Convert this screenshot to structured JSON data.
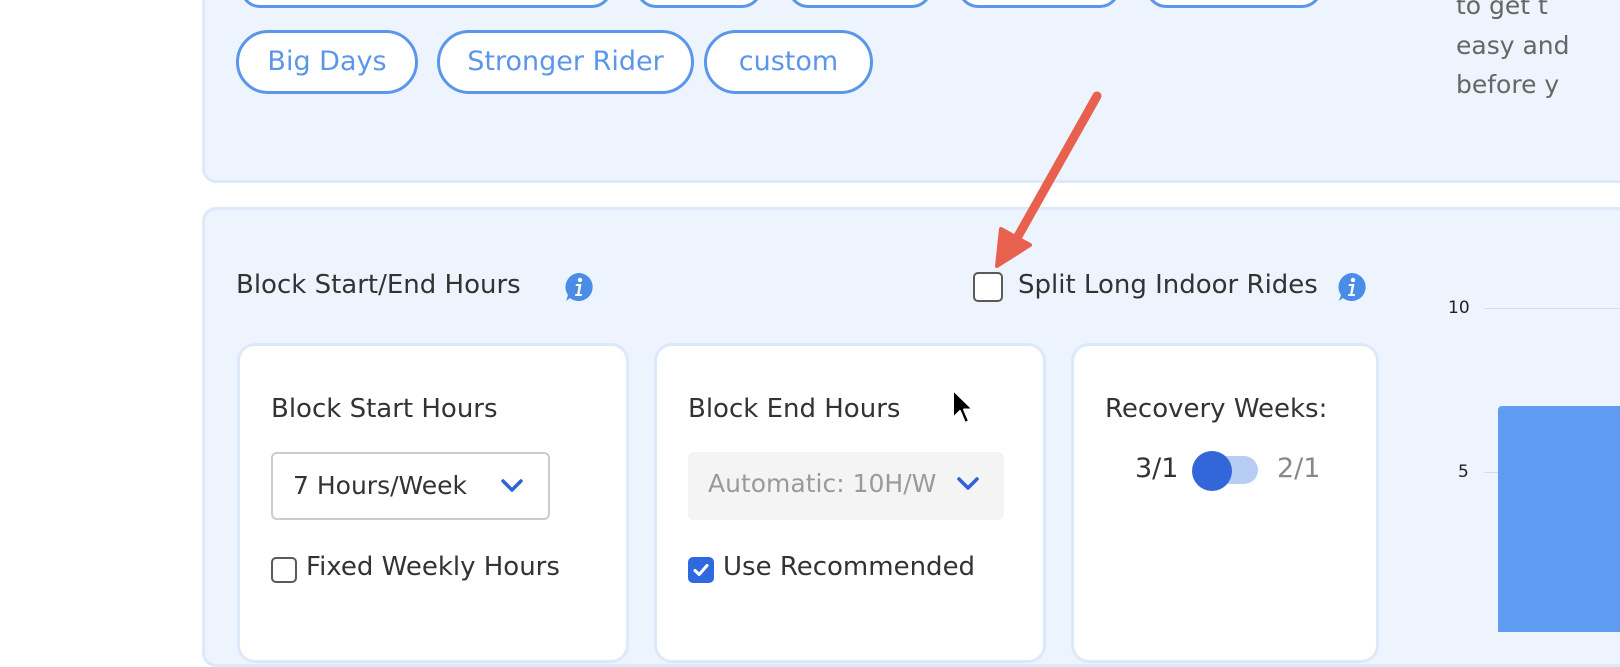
{
  "presets": {
    "row2": [
      "Big Days",
      "Stronger Rider",
      "custom"
    ]
  },
  "side_text": [
    "to get t",
    "easy and",
    "before y"
  ],
  "block_section": {
    "title": "Block Start/End Hours",
    "split_label": "Split Long Indoor Rides",
    "split_checked": false
  },
  "start_card": {
    "title": "Block Start Hours",
    "select_value": "7 Hours/Week",
    "checkbox_label": "Fixed Weekly Hours",
    "checkbox_checked": false
  },
  "end_card": {
    "title": "Block End Hours",
    "select_value": "Automatic: 10H/W",
    "checkbox_label": "Use Recommended",
    "checkbox_checked": true
  },
  "recovery_card": {
    "title": "Recovery Weeks:",
    "option_left": "3/1",
    "option_right": "2/1"
  },
  "chart_data": {
    "type": "bar",
    "y_ticks": [
      "10",
      "5"
    ],
    "values": [
      7
    ]
  },
  "colors": {
    "accent": "#5b96ea",
    "panel_bg": "#edf4fe",
    "toggle_knob": "#3367d9",
    "annotation_arrow": "#e8604e"
  }
}
